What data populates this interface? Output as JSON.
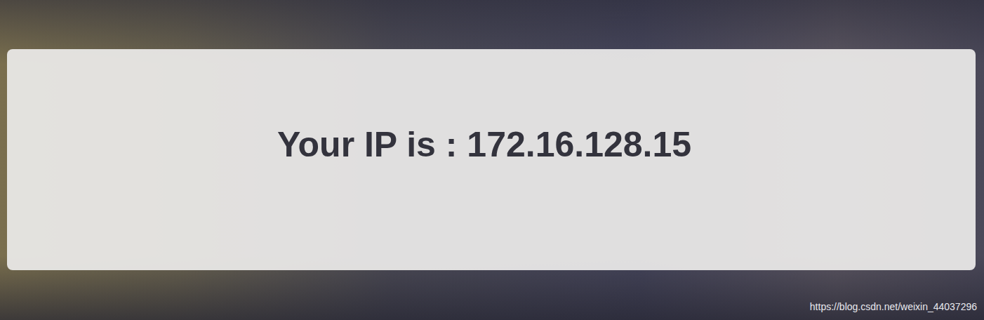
{
  "card": {
    "text": "Your IP is : 172.16.128.15"
  },
  "watermark": {
    "text": "https://blog.csdn.net/weixin_44037296"
  }
}
